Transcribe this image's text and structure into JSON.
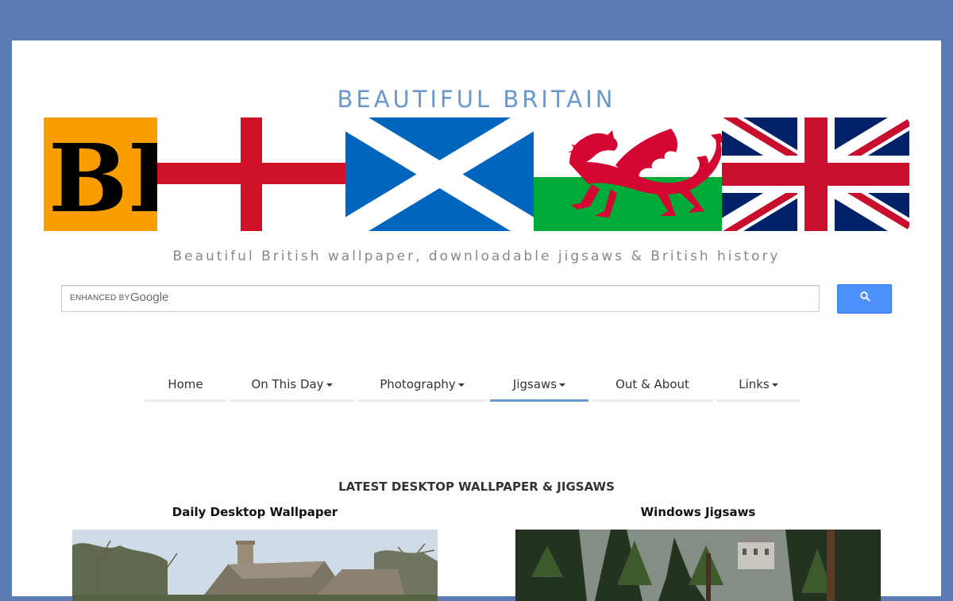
{
  "header": {
    "title": "BEAUTIFUL BRITAIN",
    "tagline": "Beautiful British wallpaper, downloadable jigsaws & British history",
    "logo_letters": "BB"
  },
  "search": {
    "enhanced_label": "ENHANCED BY",
    "google_label": "Google",
    "value": "",
    "placeholder": ""
  },
  "nav": {
    "items": [
      {
        "label": "Home"
      },
      {
        "label": "On This Day"
      },
      {
        "label": "Photography"
      },
      {
        "label": "Jigsaws",
        "active": true
      },
      {
        "label": "Out & About"
      },
      {
        "label": "Links"
      }
    ]
  },
  "content": {
    "section_heading": "LATEST DESKTOP WALLPAPER & JIGSAWS",
    "left_heading": "Daily Desktop Wallpaper",
    "right_heading": "Windows Jigsaws"
  },
  "colors": {
    "frame": "#5b7bb4",
    "accent": "#6a97cc",
    "search_button": "#4d90fe",
    "logo_orange": "#f99d00",
    "st_george_red": "#ce1126",
    "saltire_blue": "#0065bd",
    "wales_green": "#00ab39"
  },
  "icons": {
    "search_button_icon": "search-icon",
    "dropdown_icon": "caret-down-icon"
  }
}
